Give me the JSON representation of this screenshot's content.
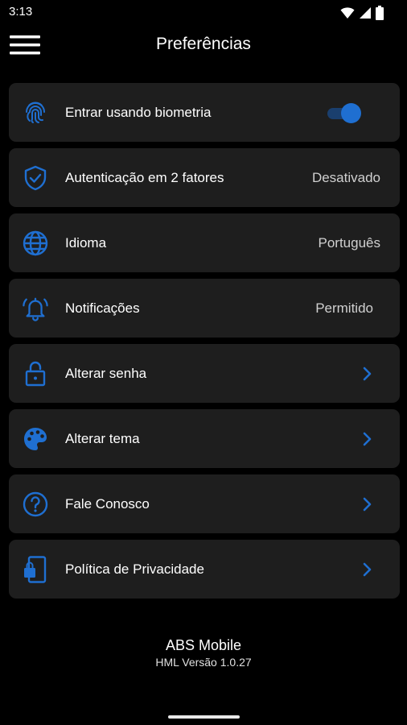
{
  "status_bar": {
    "time": "3:13",
    "icons": [
      "wifi-icon",
      "signal-icon",
      "battery-icon"
    ]
  },
  "app_bar": {
    "title": "Preferências",
    "menu_icon": "hamburger-menu-icon"
  },
  "colors": {
    "accent": "#1f6fd1",
    "card_background": "#1e1e1e",
    "background": "#000000"
  },
  "settings": [
    {
      "icon": "fingerprint-icon",
      "label": "Entrar usando biometria",
      "control": "toggle",
      "enabled": true
    },
    {
      "icon": "shield-check-icon",
      "label": "Autenticação em 2 fatores",
      "value": "Desativado"
    },
    {
      "icon": "globe-icon",
      "label": "Idioma",
      "value": "Português"
    },
    {
      "icon": "bell-icon",
      "label": "Notificações",
      "value": "Permitido"
    },
    {
      "icon": "lock-icon",
      "label": "Alterar senha",
      "control": "chevron"
    },
    {
      "icon": "palette-icon",
      "label": "Alterar tema",
      "control": "chevron"
    },
    {
      "icon": "help-circle-icon",
      "label": "Fale Conosco",
      "control": "chevron"
    },
    {
      "icon": "phone-lock-icon",
      "label": "Política de Privacidade",
      "control": "chevron"
    }
  ],
  "footer": {
    "app_name": "ABS Mobile",
    "version": "HML Versão 1.0.27"
  }
}
